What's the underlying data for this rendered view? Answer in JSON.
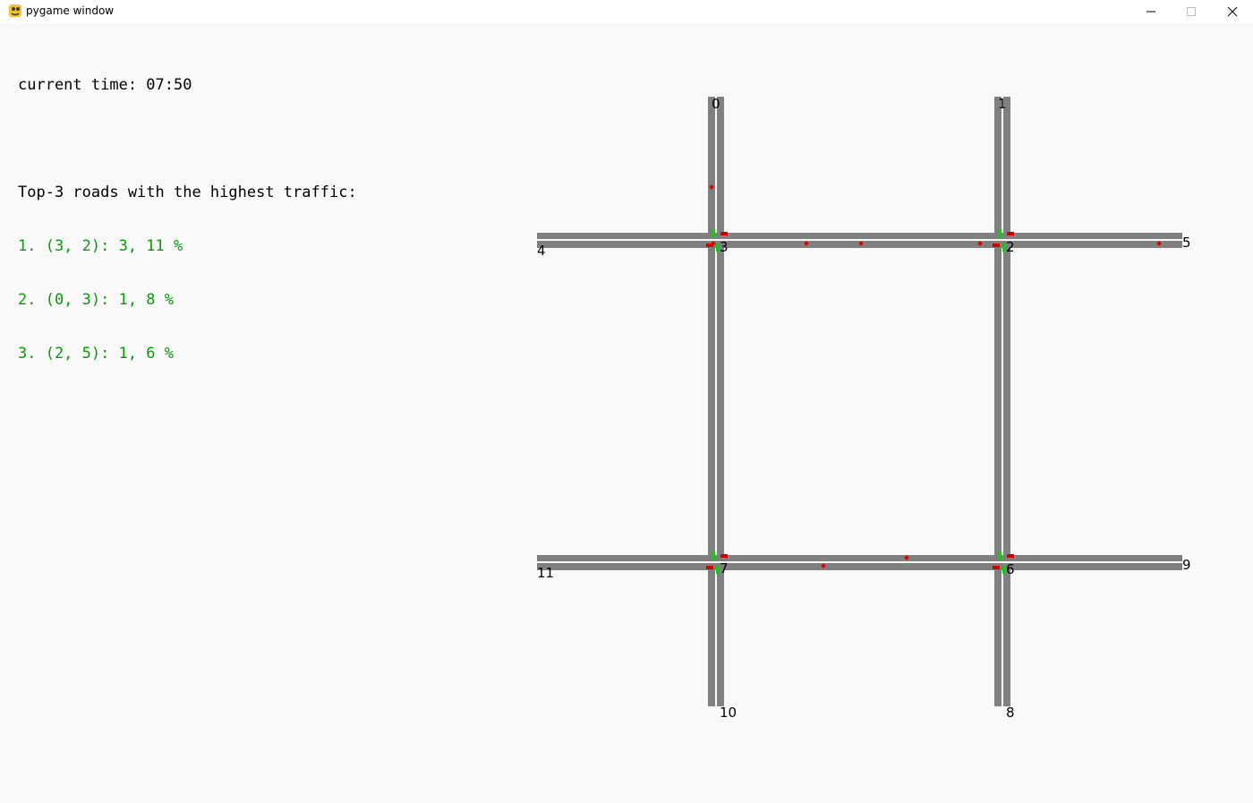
{
  "window": {
    "title": "pygame window",
    "icon": "pygame-snake-icon",
    "controls": [
      "minimize-icon",
      "maximize-icon",
      "close-icon"
    ]
  },
  "status": {
    "time_text": "current time: 07:50",
    "top_roads_heading": "Top-3 roads with the highest traffic:",
    "top_roads": [
      "1. (3, 2): 3, 11 %",
      "2. (0, 3): 1, 8 %",
      "3. (2, 5): 1, 6 %"
    ]
  },
  "map": {
    "nodes": [
      "0",
      "1",
      "2",
      "3",
      "4",
      "5",
      "6",
      "7",
      "8",
      "9",
      "10",
      "11"
    ],
    "colors": {
      "road": "#808080",
      "lane_divider": "#f9f9f9",
      "vehicle": "#e00000",
      "light_green": "#1fc31f",
      "light_red": "#d40000",
      "highlight_text": "#0a9a0a"
    }
  }
}
